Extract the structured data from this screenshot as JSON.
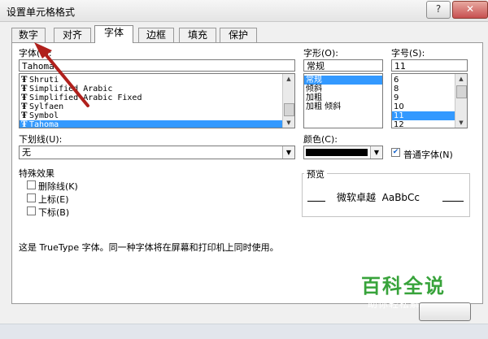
{
  "window": {
    "title": "设置单元格格式",
    "help_label": "?",
    "close_label": "✕"
  },
  "tabs": [
    "数字",
    "对齐",
    "字体",
    "边框",
    "填充",
    "保护"
  ],
  "font": {
    "label": "字体(F):",
    "value": "Tahoma",
    "list": [
      {
        "name": "Shruti",
        "selected": false
      },
      {
        "name": "Simplified Arabic",
        "selected": false
      },
      {
        "name": "Simplified Arabic Fixed",
        "selected": false
      },
      {
        "name": "Sylfaen",
        "selected": false
      },
      {
        "name": "Symbol",
        "selected": false
      },
      {
        "name": "Tahoma",
        "selected": true
      }
    ]
  },
  "style": {
    "label": "字形(O):",
    "value": "常规",
    "list": [
      {
        "name": "常规",
        "selected": true
      },
      {
        "name": "倾斜",
        "selected": false
      },
      {
        "name": "加粗",
        "selected": false
      },
      {
        "name": "加粗 倾斜",
        "selected": false
      }
    ]
  },
  "size": {
    "label": "字号(S):",
    "value": "11",
    "list": [
      {
        "name": "6",
        "selected": false
      },
      {
        "name": "8",
        "selected": false
      },
      {
        "name": "9",
        "selected": false
      },
      {
        "name": "10",
        "selected": false
      },
      {
        "name": "11",
        "selected": true
      },
      {
        "name": "12",
        "selected": false
      }
    ]
  },
  "underline": {
    "label": "下划线(U):",
    "value": "无"
  },
  "color": {
    "label": "颜色(C):",
    "value_color": "#000000",
    "normal_font_label": "普通字体(N)",
    "normal_font_checked": true
  },
  "effects": {
    "title": "特殊效果",
    "items": [
      {
        "label": "删除线(K)",
        "checked": false
      },
      {
        "label": "上标(E)",
        "checked": false
      },
      {
        "label": "下标(B)",
        "checked": false
      }
    ]
  },
  "preview": {
    "title": "预览",
    "sample": "微软卓越  AaBbCc"
  },
  "info_text": "这是 TrueType 字体。同一种字体将在屏幕和打印机上同时使用。",
  "watermark": {
    "title": "百科全说",
    "subtitle": "助你轻松解决"
  },
  "colors": {
    "accent": "#3399ff",
    "arrow": "#b0201c",
    "watermark": "#38a33b"
  }
}
